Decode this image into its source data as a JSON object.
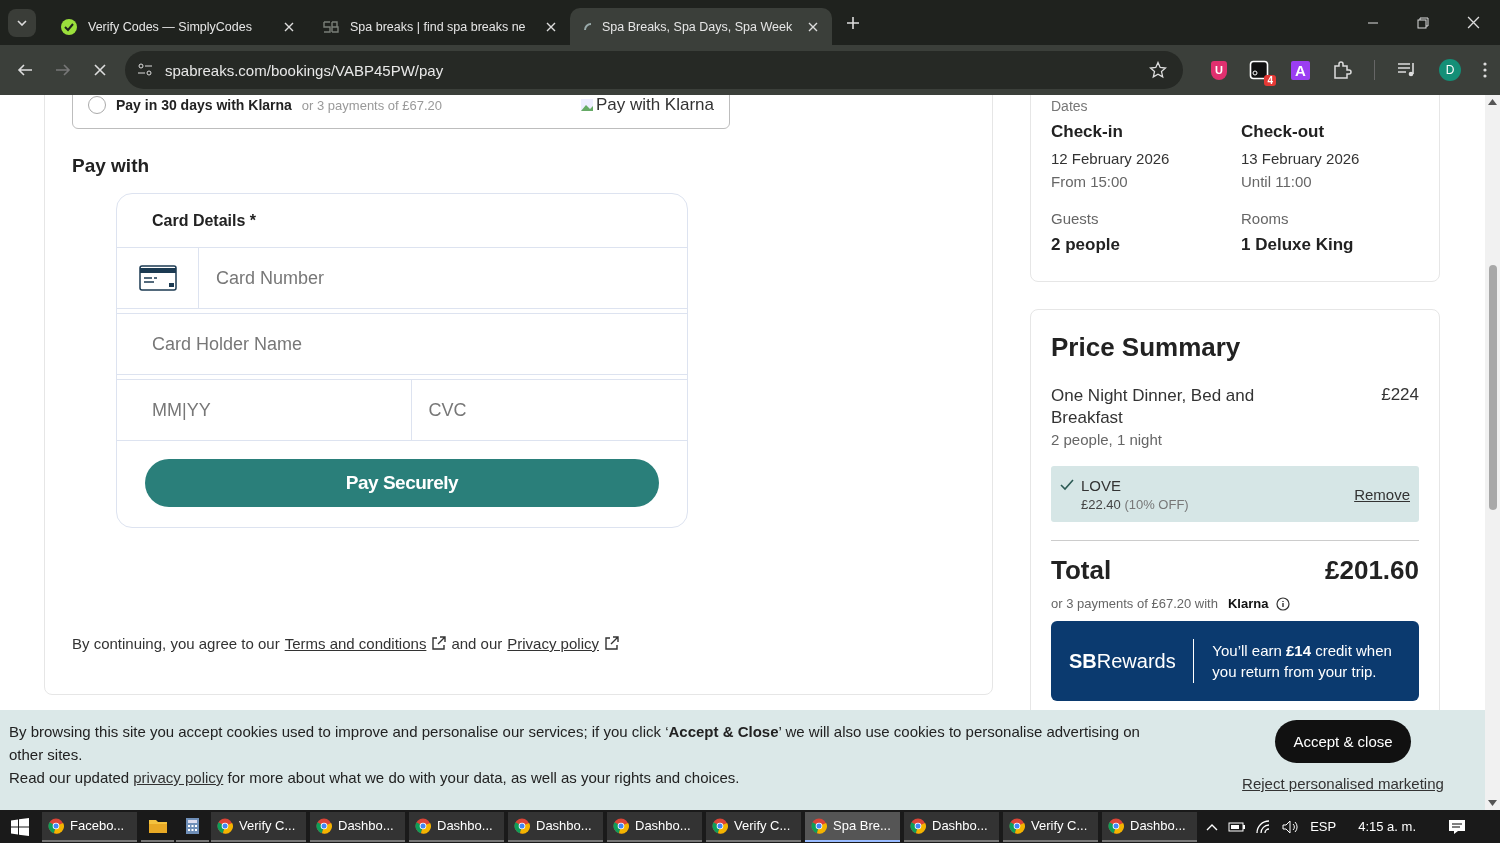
{
  "browser": {
    "tabs": [
      {
        "title": "Verify Codes — SimplyCodes",
        "kind": "check",
        "selected": false
      },
      {
        "title": "Spa breaks | find spa breaks ne",
        "kind": "sb",
        "selected": false
      },
      {
        "title": "Spa Breaks, Spa Days, Spa Week",
        "kind": "loading",
        "selected": true
      }
    ],
    "address": "spabreaks.com/bookings/VABP45PW/pay",
    "extensions": [
      {
        "kind": "shield",
        "label": "U"
      },
      {
        "kind": "box",
        "badge": "4"
      },
      {
        "kind": "letter",
        "label": "A"
      },
      {
        "kind": "puzzle"
      }
    ],
    "profile": "D"
  },
  "payment": {
    "klarna_option": {
      "label": "Pay in 30 days with Klarna",
      "note": "or 3 payments of £67.20",
      "selected": false,
      "image_alt": "Pay with Klarna"
    },
    "heading": "Pay with",
    "card_form": {
      "title": "Card Details *",
      "card_number": {
        "placeholder": "Card Number"
      },
      "holder_name": {
        "placeholder": "Card Holder Name"
      },
      "expiry": {
        "placeholder": "MM|YY"
      },
      "cvc": {
        "placeholder": "CVC"
      },
      "button": "Pay Securely"
    },
    "consent": {
      "before": "By continuing, you agree to our",
      "link_1": "Terms and conditions",
      "middle": "and our",
      "link_2": "Privacy policy"
    }
  },
  "booking": {
    "section_label": "Dates",
    "items": [
      {
        "label": "Check-in",
        "value": "12 February 2026",
        "note": "From 15:00"
      },
      {
        "label": "Check-out",
        "value": "13 February 2026",
        "note": "Until 11:00"
      },
      {
        "label": "Guests",
        "value": "2 people"
      },
      {
        "label": "Rooms",
        "value": "1 Deluxe King"
      }
    ]
  },
  "price_summary": {
    "title": "Price Summary",
    "item": {
      "name": "One Night Dinner, Bed and Breakfast",
      "detail": "2 people, 1 night",
      "price": "£224"
    },
    "discount": {
      "code": "LOVE",
      "amount": "£22.40",
      "percent": "(10% OFF)",
      "action": "Remove"
    },
    "total_label": "Total",
    "total": "£201.60",
    "installments": "or 3 payments of £67.20 with",
    "provider": "Klarna",
    "rewards": {
      "brand_bold": "SB",
      "brand_rest": "Rewards",
      "text": "You’ll earn **£14** credit when you return from your trip."
    }
  },
  "cookie_banner": {
    "text": "By browsing this site you accept cookies used to improve and personalise our services; if you click ‘**Accept & Close**’ we will also use cookies to personalise advertising on other sites.",
    "line_2_before": "Read our updated",
    "line_2_link": "privacy policy",
    "line_2_after": "for more about what we do with your data, as well as your rights and choices.",
    "accept": "Accept & close",
    "reject": "Reject personalised marketing"
  },
  "taskbar": {
    "apps": [
      {
        "kind": "chrome",
        "label": "Facebo...",
        "selected": false
      },
      {
        "kind": "folder",
        "selected": false
      },
      {
        "kind": "calculator",
        "selected": false
      },
      {
        "kind": "chrome",
        "label": "Verify C...",
        "selected": false
      },
      {
        "kind": "chrome",
        "label": "Dashbo...",
        "selected": false
      },
      {
        "kind": "chrome",
        "label": "Dashbo...",
        "selected": false
      },
      {
        "kind": "chrome",
        "label": "Dashbo...",
        "selected": false
      },
      {
        "kind": "chrome",
        "label": "Dashbo...",
        "selected": false
      },
      {
        "kind": "chrome",
        "label": "Verify C...",
        "selected": false
      },
      {
        "kind": "chrome",
        "label": "Spa Bre...",
        "selected": true
      },
      {
        "kind": "chrome",
        "label": "Dashbo...",
        "selected": false
      },
      {
        "kind": "chrome",
        "label": "Verify C...",
        "selected": false
      },
      {
        "kind": "chrome",
        "label": "Dashbo...",
        "selected": false
      }
    ],
    "language": "ESP",
    "time": "4:15 a. m."
  }
}
